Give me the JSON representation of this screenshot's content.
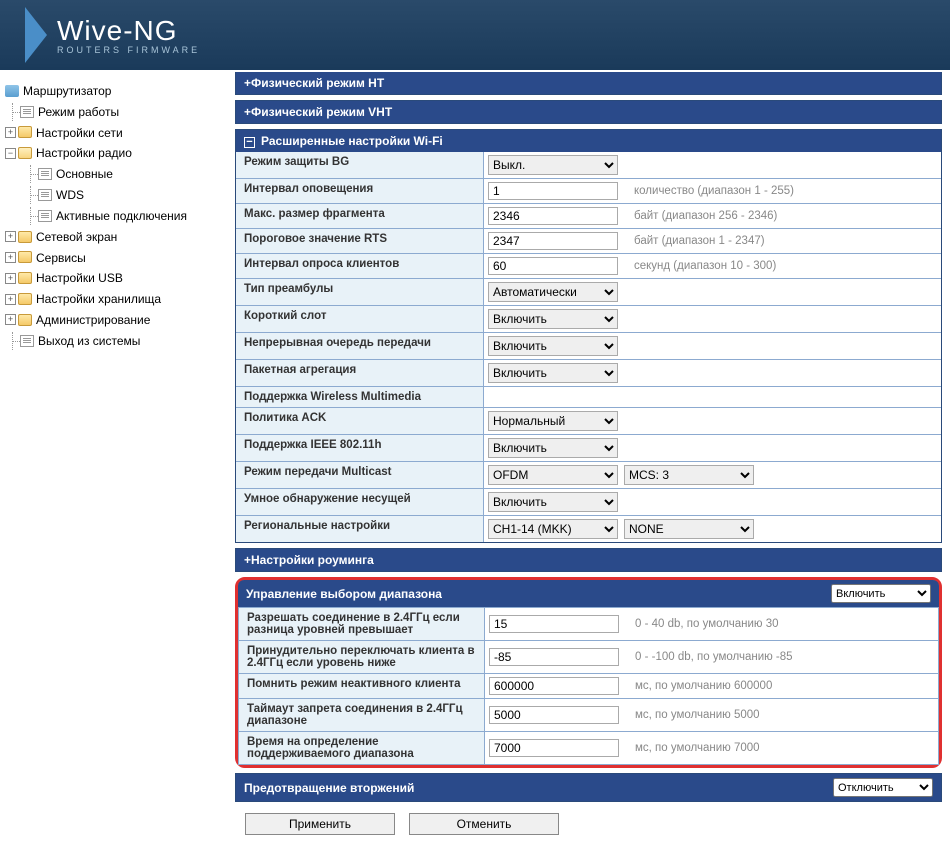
{
  "logo": {
    "main": "Wive-NG",
    "sub": "ROUTERS FIRMWARE"
  },
  "tree": {
    "root": "Маршрутизатор",
    "mode": "Режим работы",
    "net": "Настройки сети",
    "radio": "Настройки радио",
    "radio_basic": "Основные",
    "radio_wds": "WDS",
    "radio_active": "Активные подключения",
    "firewall": "Сетевой экран",
    "services": "Сервисы",
    "usb": "Настройки USB",
    "storage": "Настройки хранилища",
    "admin": "Администрирование",
    "logout": "Выход из системы"
  },
  "sections": {
    "phy_ht": "Физический режим HT",
    "phy_vht": "Физический режим VHT",
    "wifi_adv": "Расширенные настройки Wi-Fi",
    "roaming": "Настройки роуминга",
    "band_steer": "Управление выбором диапазона",
    "intrusion": "Предотвращение вторжений"
  },
  "wifi": {
    "bg_protect": {
      "label": "Режим защиты BG",
      "value": "Выкл."
    },
    "beacon": {
      "label": "Интервал оповещения",
      "value": "1",
      "hint": "количество (диапазон 1 - 255)"
    },
    "frag": {
      "label": "Макс. размер фрагмента",
      "value": "2346",
      "hint": "байт (диапазон 256 - 2346)"
    },
    "rts": {
      "label": "Пороговое значение RTS",
      "value": "2347",
      "hint": "байт (диапазон 1 - 2347)"
    },
    "poll": {
      "label": "Интервал опроса клиентов",
      "value": "60",
      "hint": "секунд (диапазон 10 - 300)"
    },
    "preamble": {
      "label": "Тип преамбулы",
      "value": "Автоматически"
    },
    "shortslot": {
      "label": "Короткий слот",
      "value": "Включить"
    },
    "txburst": {
      "label": "Непрерывная очередь передачи",
      "value": "Включить"
    },
    "pktaggr": {
      "label": "Пакетная агрегация",
      "value": "Включить"
    },
    "wmm": {
      "label": "Поддержка Wireless Multimedia"
    },
    "ack": {
      "label": "Политика ACK",
      "value": "Нормальный"
    },
    "dot11h": {
      "label": "Поддержка IEEE 802.11h",
      "value": "Включить"
    },
    "mcast": {
      "label": "Режим передачи Multicast",
      "value": "OFDM",
      "mcs": "MCS: 3"
    },
    "carrier": {
      "label": "Умное обнаружение несущей",
      "value": "Включить"
    },
    "region": {
      "label": "Региональные настройки",
      "value": "CH1-14 (MKK)",
      "value2": "NONE"
    }
  },
  "band": {
    "enable": "Включить",
    "rssi_diff": {
      "label": "Разрешать соединение в 2.4ГГц если разница уровней превышает",
      "value": "15",
      "hint": "0 - 40 db, по умолчанию 30"
    },
    "force_24": {
      "label": "Принудительно переключать клиента в 2.4ГГц если уровень ниже",
      "value": "-85",
      "hint": "0 - -100 db, по умолчанию -85"
    },
    "idle": {
      "label": "Помнить режим неактивного клиента",
      "value": "600000",
      "hint": "мс, по умолчанию 600000"
    },
    "hold": {
      "label": "Таймаут запрета соединения в 2.4ГГц диапазоне",
      "value": "5000",
      "hint": "мс, по умолчанию 5000"
    },
    "check": {
      "label": "Время на определение поддерживаемого диапазона",
      "value": "7000",
      "hint": "мс, по умолчанию 7000"
    }
  },
  "intrusion_value": "Отключить",
  "buttons": {
    "apply": "Применить",
    "cancel": "Отменить"
  }
}
